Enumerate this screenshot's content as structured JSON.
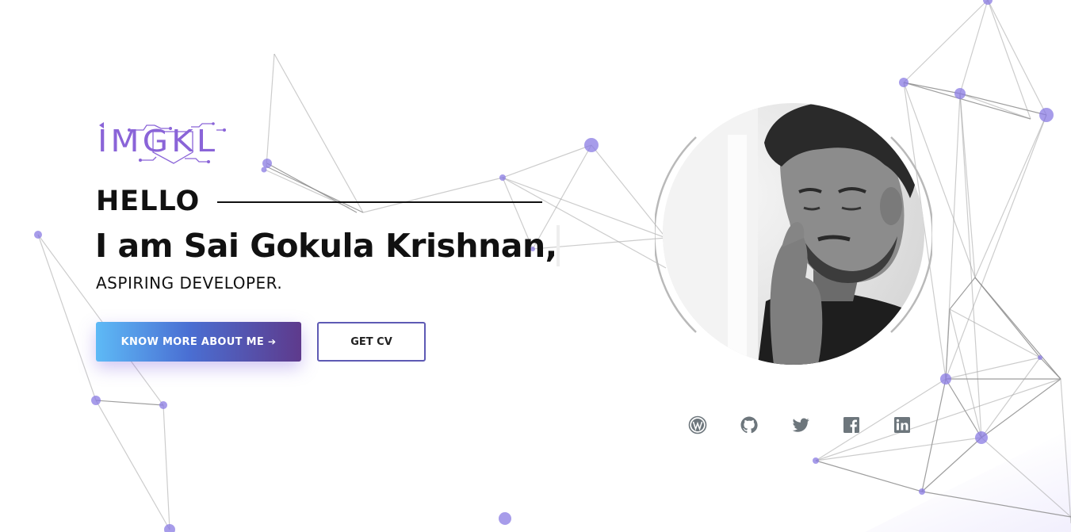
{
  "brand": {
    "logo_text": "IMGKL"
  },
  "hero": {
    "greeting": "HELLO",
    "name_line": "I am Sai Gokula Krishnan,",
    "role": "ASPIRING DEVELOPER."
  },
  "buttons": {
    "primary_label": "KNOW MORE ABOUT ME",
    "primary_arrow": "➔",
    "secondary_label": "GET CV"
  },
  "social_links": [
    {
      "name": "wordpress",
      "icon": "wordpress-icon"
    },
    {
      "name": "github",
      "icon": "github-icon"
    },
    {
      "name": "twitter",
      "icon": "twitter-icon"
    },
    {
      "name": "facebook",
      "icon": "facebook-icon"
    },
    {
      "name": "linkedin",
      "icon": "linkedin-icon"
    }
  ],
  "colors": {
    "accent_purple": "#8a64d8",
    "node_purple": "#8a7be3",
    "button_gradient_start": "#5ebaf6",
    "button_gradient_end": "#5e3a8c",
    "text_dark": "#111111",
    "social_icon": "#6d767c"
  }
}
